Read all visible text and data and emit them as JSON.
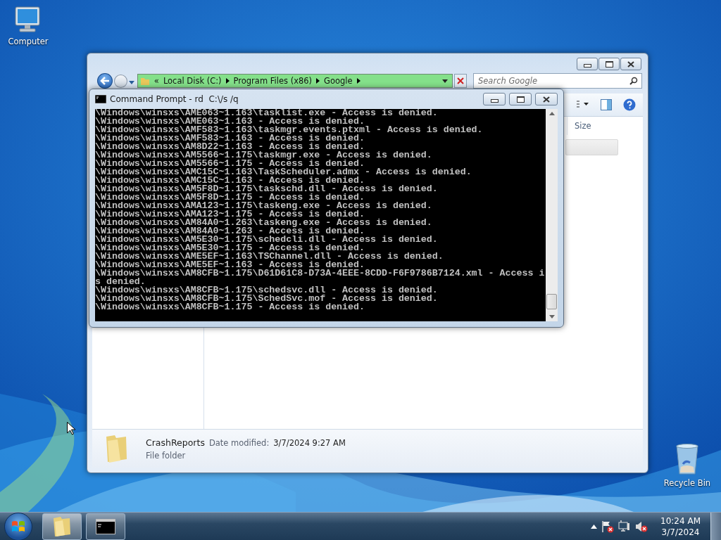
{
  "desktop_icons": [
    {
      "kind": "computer",
      "label": "Computer"
    },
    {
      "kind": "recycle-bin",
      "label": "Recycle Bin"
    }
  ],
  "explorer": {
    "address": {
      "overflow": "«",
      "crumbs": [
        "Local Disk (C:)",
        "Program Files (x86)",
        "Google"
      ]
    },
    "search": {
      "placeholder": "Search Google"
    },
    "columns": [
      "Size"
    ],
    "details": {
      "name": "CrashReports",
      "date_label": "Date modified:",
      "date": "3/7/2024 9:27 AM",
      "type": "File folder"
    }
  },
  "console": {
    "title": "Command Prompt - rd  C:\\/s /q",
    "lines": [
      "\\Windows\\winsxs\\AME063~1.163\\tasklist.exe - Access is denied.",
      "\\Windows\\winsxs\\AME063~1.163 - Access is denied.",
      "\\Windows\\winsxs\\AMF583~1.163\\taskmgr.events.ptxml - Access is denied.",
      "\\Windows\\winsxs\\AMF583~1.163 - Access is denied.",
      "\\Windows\\winsxs\\AM8D22~1.163 - Access is denied.",
      "\\Windows\\winsxs\\AM5566~1.175\\taskmgr.exe - Access is denied.",
      "\\Windows\\winsxs\\AM5566~1.175 - Access is denied.",
      "\\Windows\\winsxs\\AMC15C~1.163\\TaskScheduler.admx - Access is denied.",
      "\\Windows\\winsxs\\AMC15C~1.163 - Access is denied.",
      "\\Windows\\winsxs\\AM5F8D~1.175\\taskschd.dll - Access is denied.",
      "\\Windows\\winsxs\\AM5F8D~1.175 - Access is denied.",
      "\\Windows\\winsxs\\AMA123~1.175\\taskeng.exe - Access is denied.",
      "\\Windows\\winsxs\\AMA123~1.175 - Access is denied.",
      "\\Windows\\winsxs\\AM84A0~1.263\\taskeng.exe - Access is denied.",
      "\\Windows\\winsxs\\AM84A0~1.263 - Access is denied.",
      "\\Windows\\winsxs\\AM5E30~1.175\\schedcli.dll - Access is denied.",
      "\\Windows\\winsxs\\AM5E30~1.175 - Access is denied.",
      "\\Windows\\winsxs\\AME5EF~1.163\\TSChannel.dll - Access is denied.",
      "\\Windows\\winsxs\\AME5EF~1.163 - Access is denied.",
      "\\Windows\\winsxs\\AM8CFB~1.175\\D61D61C8-D73A-4EEE-8CDD-F6F9786B7124.xml - Access is denied.",
      "\\Windows\\winsxs\\AM8CFB~1.175\\schedsvc.dll - Access is denied.",
      "\\Windows\\winsxs\\AM8CFB~1.175\\SchedSvc.mof - Access is denied.",
      "\\Windows\\winsxs\\AM8CFB~1.175 - Access is denied."
    ]
  },
  "taskbar": {
    "buttons": [
      {
        "kind": "explorer"
      },
      {
        "kind": "console"
      }
    ],
    "clock": {
      "time": "10:24 AM",
      "date": "3/7/2024"
    }
  }
}
